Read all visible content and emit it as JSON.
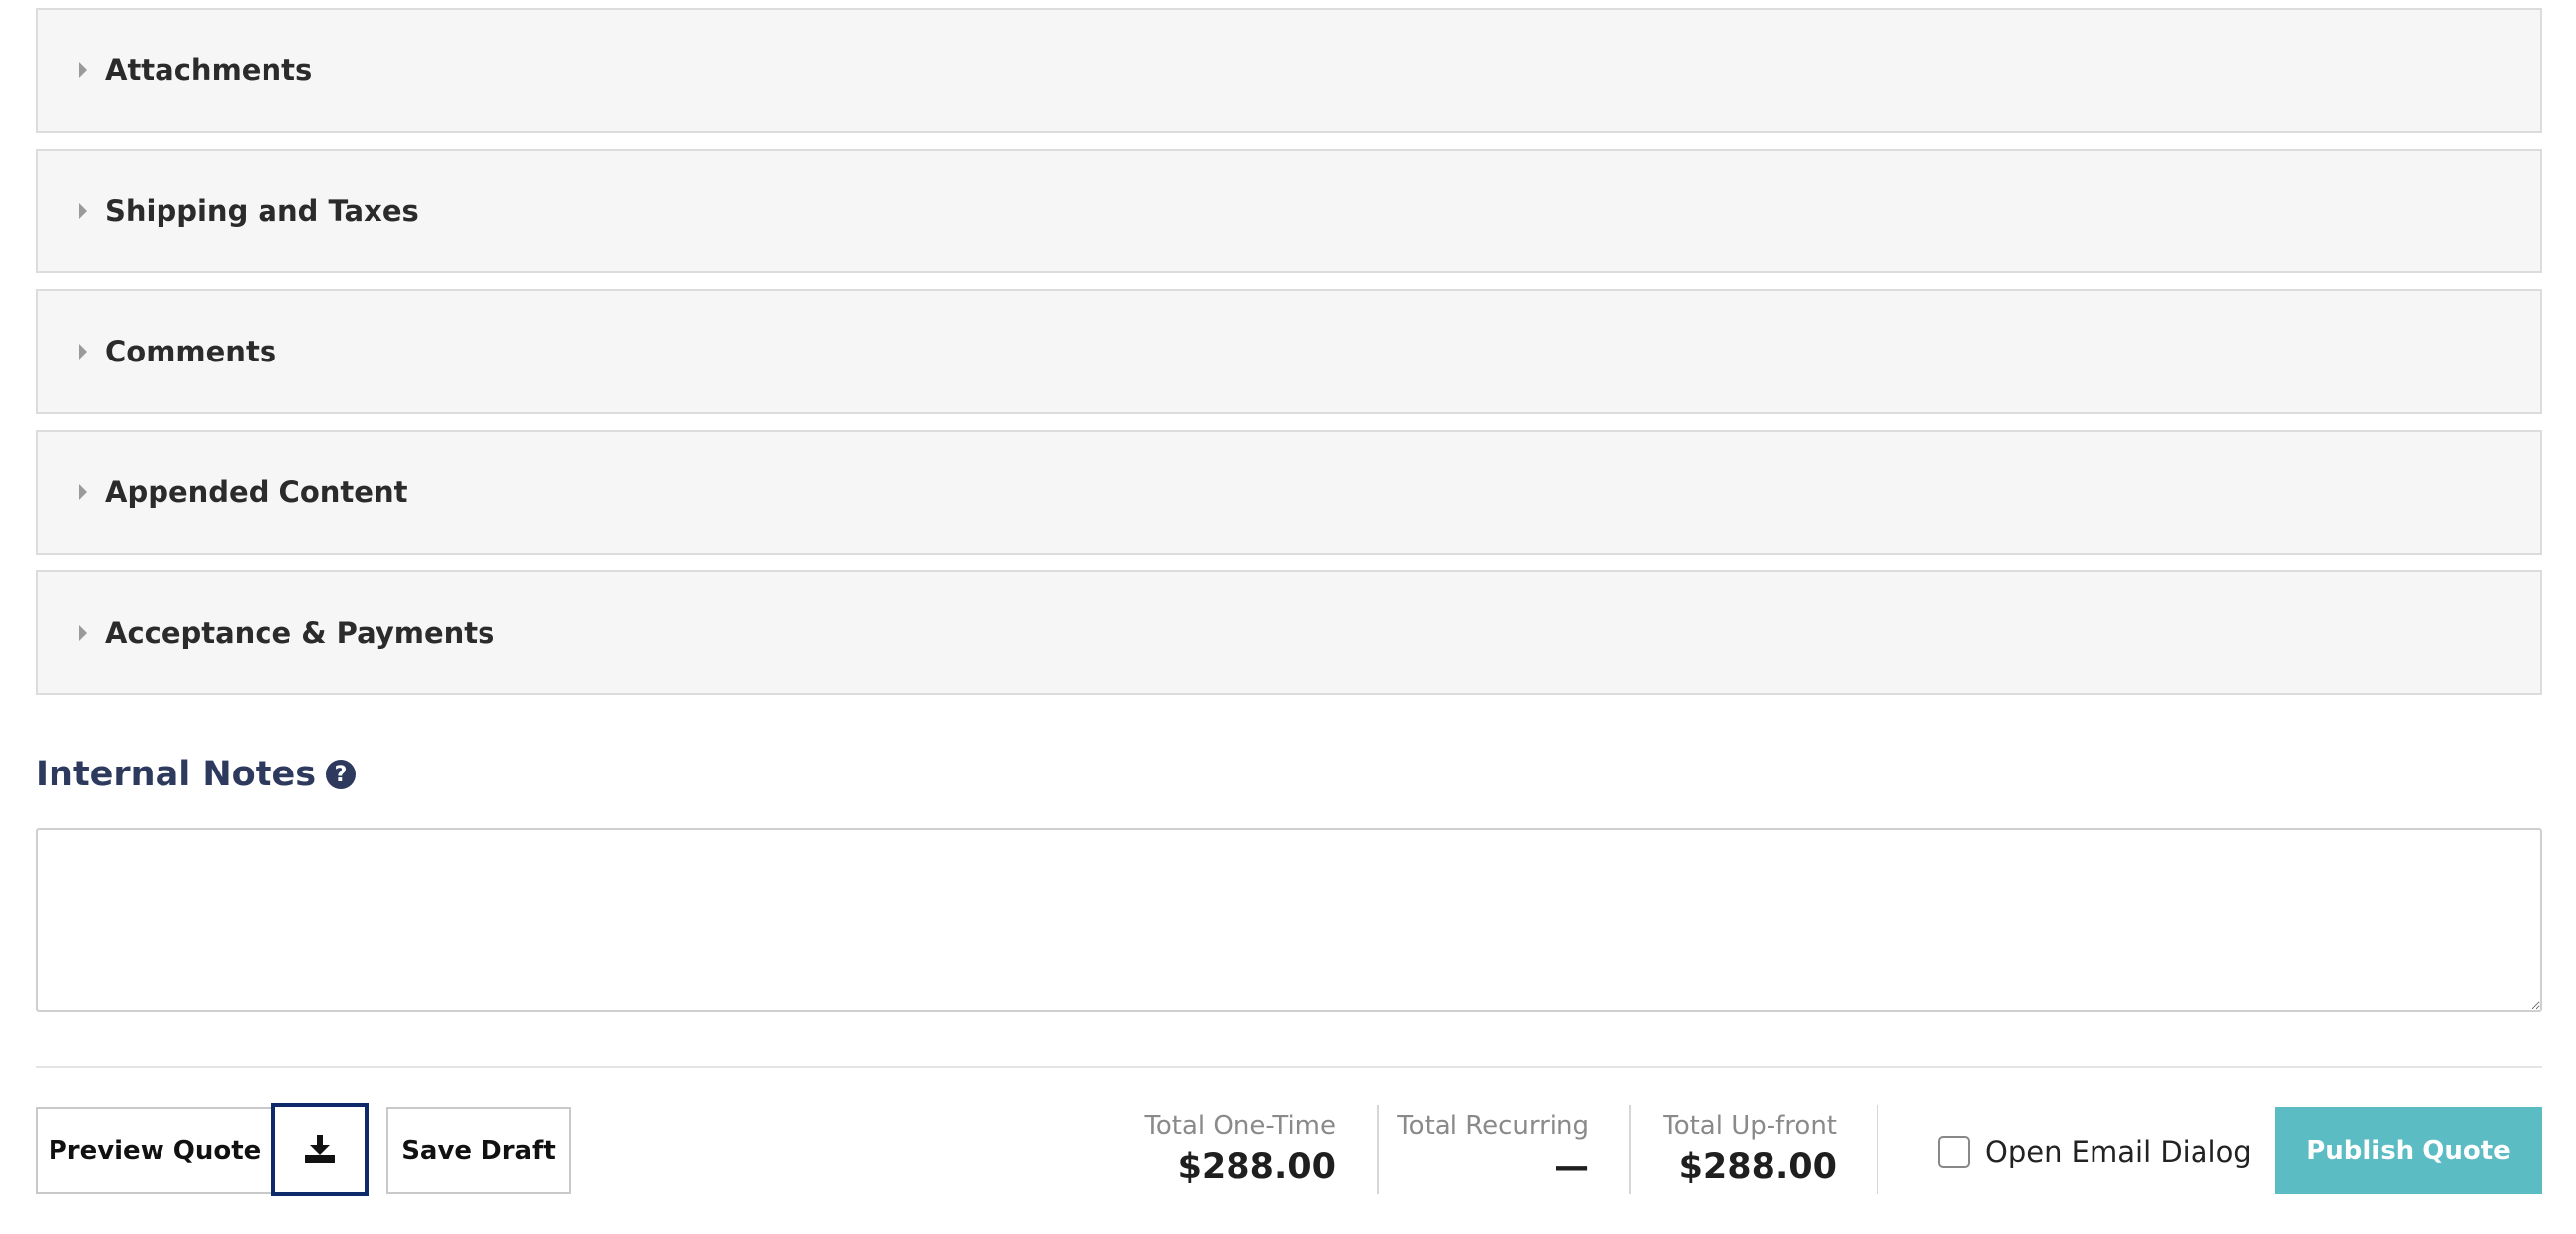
{
  "sections": [
    {
      "label": "Attachments"
    },
    {
      "label": "Shipping and Taxes"
    },
    {
      "label": "Comments"
    },
    {
      "label": "Appended Content"
    },
    {
      "label": "Acceptance & Payments"
    }
  ],
  "internal_notes": {
    "heading": "Internal Notes",
    "help_icon": "question-circle-icon",
    "value": ""
  },
  "actions": {
    "preview_label": "Preview Quote",
    "download_icon": "download-icon",
    "save_label": "Save Draft",
    "publish_label": "Publish Quote"
  },
  "totals": {
    "one_time_label": "Total One-Time",
    "one_time_value": "$288.00",
    "recurring_label": "Total Recurring",
    "recurring_value": "—",
    "upfront_label": "Total Up-front",
    "upfront_value": "$288.00"
  },
  "email_dialog": {
    "label": "Open Email Dialog",
    "checked": false
  },
  "colors": {
    "heading": "#2d3a5e",
    "publish_button": "#5bbcc4",
    "download_focus_border": "#0e2a6a",
    "section_background": "#f6f6f6"
  }
}
